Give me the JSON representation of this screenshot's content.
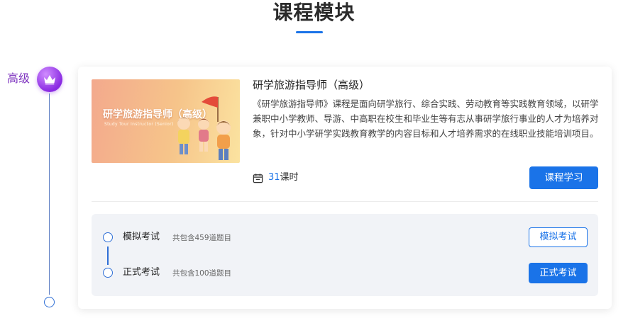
{
  "section": {
    "title": "课程模块"
  },
  "level": {
    "label": "高级",
    "icon": "crown-icon"
  },
  "course": {
    "cover_title": "研学旅游指导师（高级）",
    "cover_subtitle": "Study Tour Instructor (Senior)",
    "name": "研学旅游指导师（高级）",
    "description": "《研学旅游指导师》课程是面向研学旅行、综合实践、劳动教育等实践教育领域，以研学兼职中小学教师、导游、中高职在校生和毕业生等有志从事研学旅行事业的人才为培养对象，针对中小学研学实践教育教学的内容目标和人才培养需求的在线职业技能培训项目。",
    "hours_value": "31",
    "hours_unit": "课时",
    "study_button": "课程学习"
  },
  "exams": [
    {
      "name": "模拟考试",
      "count": "共包含459道题目",
      "button": "模拟考试"
    },
    {
      "name": "正式考试",
      "count": "共包含100道题目",
      "button": "正式考试"
    }
  ],
  "colors": {
    "primary": "#1a73e8",
    "level": "#7b2fbe",
    "panel": "#f1f3f7"
  }
}
